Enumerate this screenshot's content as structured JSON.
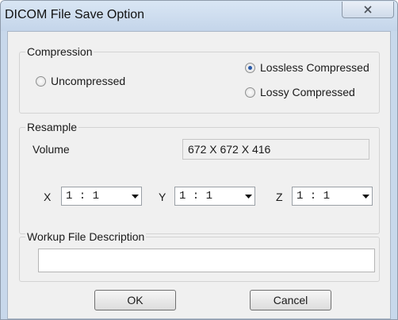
{
  "dialog": {
    "title": "DICOM File Save Option",
    "close_icon": "close-icon"
  },
  "compression": {
    "legend": "Compression",
    "options": [
      {
        "label": "Uncompressed",
        "checked": false
      },
      {
        "label": "Lossless Compressed",
        "checked": true
      },
      {
        "label": "Lossy Compressed",
        "checked": false
      }
    ]
  },
  "resample": {
    "legend": "Resample",
    "volume_label": "Volume",
    "volume_value": "672 X 672 X 416",
    "x_label": "X",
    "x_value": "1 : 1",
    "y_label": "Y",
    "y_value": "1 : 1",
    "z_label": "Z",
    "z_value": "1 : 1",
    "dropdown_icon": "chevron-down-icon"
  },
  "workup": {
    "legend": "Workup File Description",
    "value": ""
  },
  "buttons": {
    "ok": "OK",
    "cancel": "Cancel"
  }
}
